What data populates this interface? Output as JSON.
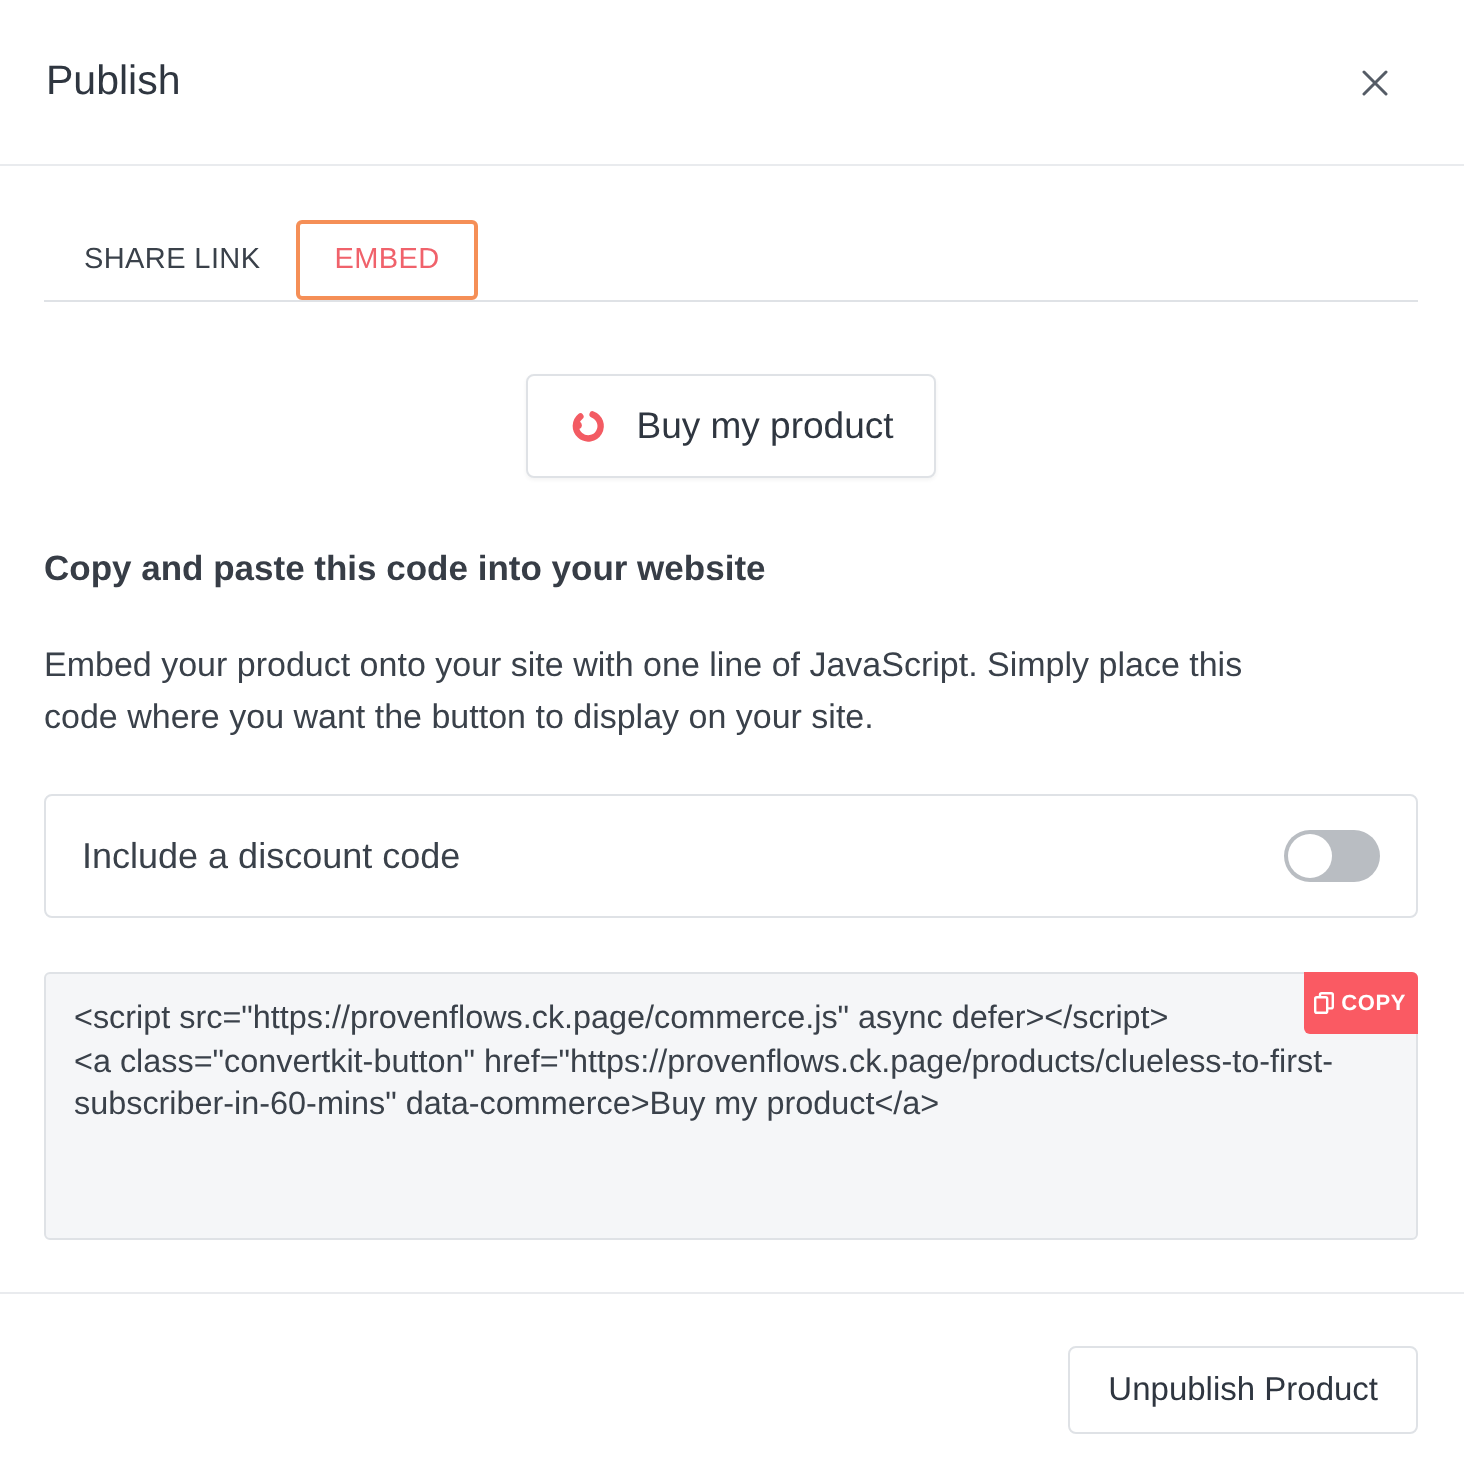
{
  "dialog": {
    "title": "Publish"
  },
  "tabs": [
    {
      "label": "SHARE LINK",
      "selected": false
    },
    {
      "label": "EMBED",
      "selected": true
    }
  ],
  "preview_button": {
    "label": "Buy my product"
  },
  "instructions": {
    "heading": "Copy and paste this code into your website",
    "text": "Embed your product onto your site with one line of JavaScript. Simply place this code where you want the button to display on your site."
  },
  "discount": {
    "label": "Include a discount code",
    "on": false
  },
  "code": {
    "lines": [
      "<script src=\"https://provenflows.ck.page/commerce.js\" async defer></script>",
      "<a class=\"convertkit-button\" href=\"https://provenflows.ck.page/products/clueless-to-first-subscriber-in-60-mins\" data-commerce>Buy my product</a>"
    ],
    "copy_label": "COPY"
  },
  "footer": {
    "buttons": [
      "Unpublish Product"
    ]
  }
}
